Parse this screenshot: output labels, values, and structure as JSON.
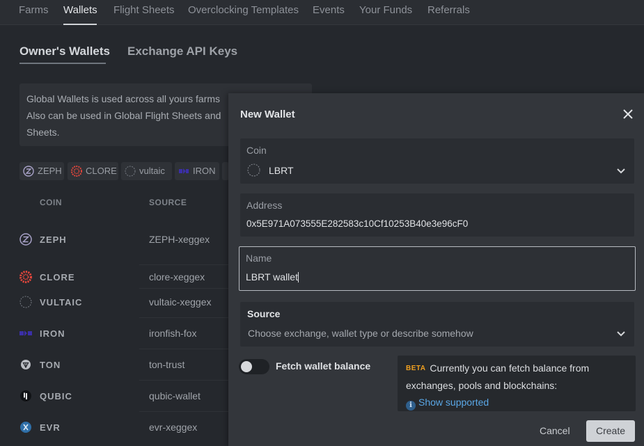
{
  "nav": {
    "tabs": [
      "Farms",
      "Wallets",
      "Flight Sheets",
      "Overclocking Templates",
      "Events",
      "Your Funds",
      "Referrals"
    ],
    "active": "Wallets"
  },
  "subtabs": {
    "owners_wallets": "Owner's Wallets",
    "exchange_api_keys": "Exchange API Keys"
  },
  "info": {
    "line1": "Global Wallets is used across all yours farms",
    "line2": "Also can be used in Global Flight Sheets and",
    "line3": "Sheets."
  },
  "chips": [
    "ZEPH",
    "CLORE",
    "vultaic",
    "IRON"
  ],
  "table": {
    "headers": {
      "coin": "COIN",
      "source": "SOURCE"
    },
    "rows": [
      {
        "coin": "ZEPH",
        "source": "ZEPH-xeggex"
      },
      {
        "coin": "CLORE",
        "source": "clore-xeggex"
      },
      {
        "coin": "VULTAIC",
        "source": "vultaic-xeggex"
      },
      {
        "coin": "IRON",
        "source": "ironfish-fox"
      },
      {
        "coin": "TON",
        "source": "ton-trust"
      },
      {
        "coin": "QUBIC",
        "source": "qubic-wallet"
      },
      {
        "coin": "EVR",
        "source": "evr-xeggex"
      }
    ]
  },
  "modal": {
    "title": "New Wallet",
    "coin": {
      "label": "Coin",
      "value": "LBRT"
    },
    "address": {
      "label": "Address",
      "value": "0x5E971A073555E282583c10Cf10253B40e3e96cF0"
    },
    "name": {
      "label": "Name",
      "value": "LBRT wallet"
    },
    "source": {
      "label": "Source",
      "placeholder": "Choose exchange, wallet type or describe somehow"
    },
    "fetch_label": "Fetch wallet balance",
    "fetch_enabled": false,
    "beta_tag": "BETA",
    "beta_text_1": "Currently you can fetch balance from",
    "beta_text_2": "exchanges, pools and blockchains:",
    "show_supported": "Show supported",
    "cancel": "Cancel",
    "create": "Create"
  },
  "colors": {
    "accent_link": "#5aa7e6",
    "beta": "#f0a020",
    "clore": "#e2463c",
    "iron": "#3b2fa8"
  }
}
